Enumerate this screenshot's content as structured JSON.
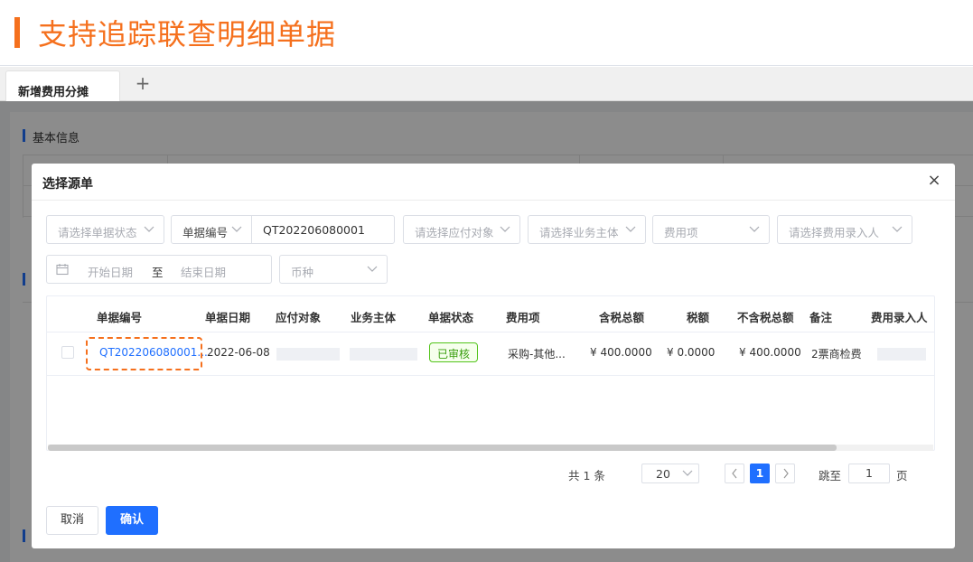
{
  "banner": {
    "title": "支持追踪联查明细单据",
    "accent": "#f5701d"
  },
  "tabs": {
    "active": "新增费用分摊",
    "add_icon": "+"
  },
  "background": {
    "section_title": "基本信息"
  },
  "modal": {
    "title": "选择源单",
    "close_icon": "×",
    "filters": {
      "status_placeholder": "请选择单据状态",
      "doc_no_type": "单据编号",
      "doc_no_value": "QT202206080001",
      "payee_placeholder": "请选择应付对象",
      "entity_placeholder": "请选择业务主体",
      "fee_item_placeholder": "费用项",
      "entry_user_placeholder": "请选择费用录入人",
      "start_date_placeholder": "开始日期",
      "date_separator": "至",
      "end_date_placeholder": "结束日期",
      "currency_placeholder": "币种"
    },
    "table": {
      "columns": [
        "单据编号",
        "单据日期",
        "应付对象",
        "业务主体",
        "单据状态",
        "费用项",
        "含税总额",
        "税额",
        "不含税总额",
        "备注",
        "费用录入人"
      ],
      "rows": [
        {
          "doc_no": "QT202206080001...",
          "date": "2022-06-08",
          "status": "已审核",
          "fee_item": "采购-其他...",
          "total_with_tax": "¥ 400.0000",
          "tax": "¥ 0.0000",
          "total_without_tax": "¥ 400.0000",
          "remark": "2票商检费"
        }
      ]
    },
    "pagination": {
      "total": "共 1 条",
      "page_size": "20",
      "current_page": "1",
      "jump_label": "跳至",
      "jump_value": "1",
      "page_unit": "页"
    },
    "buttons": {
      "cancel": "取消",
      "confirm": "确认"
    }
  },
  "colors": {
    "primary": "#1f6fff",
    "accent": "#f5701d",
    "success": "#52c41a"
  }
}
